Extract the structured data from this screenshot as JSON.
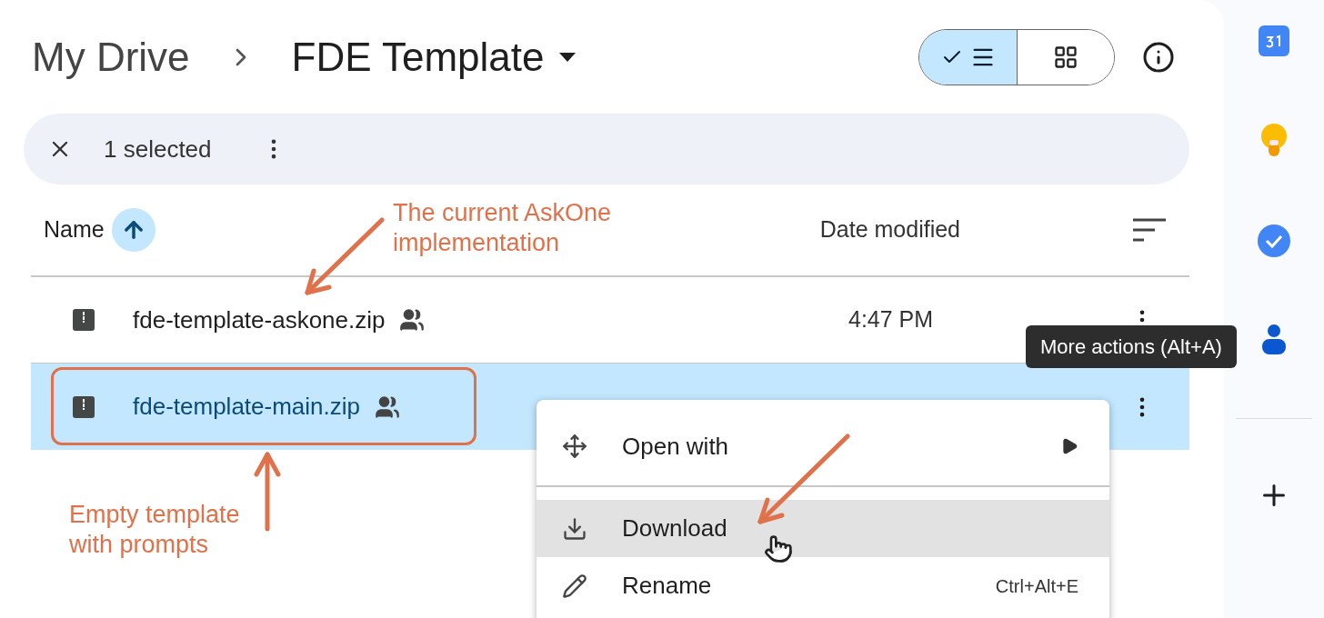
{
  "breadcrumb": [
    {
      "label": "My Drive",
      "current": false
    },
    {
      "label": "FDE Template",
      "current": true
    }
  ],
  "view_toggle": [
    {
      "kind": "list",
      "selected": true
    },
    {
      "kind": "grid",
      "selected": false
    }
  ],
  "selection_bar": {
    "count": "1 selected"
  },
  "columns": [
    "Name",
    "Date modified"
  ],
  "files": [
    {
      "name": "fde-template-askone.zip",
      "modified": "4:47 PM",
      "shared": true,
      "selected": false
    },
    {
      "name": "fde-template-main.zip",
      "shared": true,
      "selected": true
    }
  ],
  "context_menu": [
    {
      "kind": "open",
      "label": "Open with",
      "submenu": true,
      "hovered": false
    },
    {
      "kind": "download",
      "label": "Download",
      "hovered": true
    },
    {
      "kind": "rename",
      "label": "Rename",
      "shortcut": "Ctrl+Alt+E",
      "hovered": false
    }
  ],
  "tooltip": "More actions (Alt+A)",
  "annotations": [
    {
      "text": "The current AskOne implementation"
    },
    {
      "text": "Empty template with prompts"
    }
  ]
}
